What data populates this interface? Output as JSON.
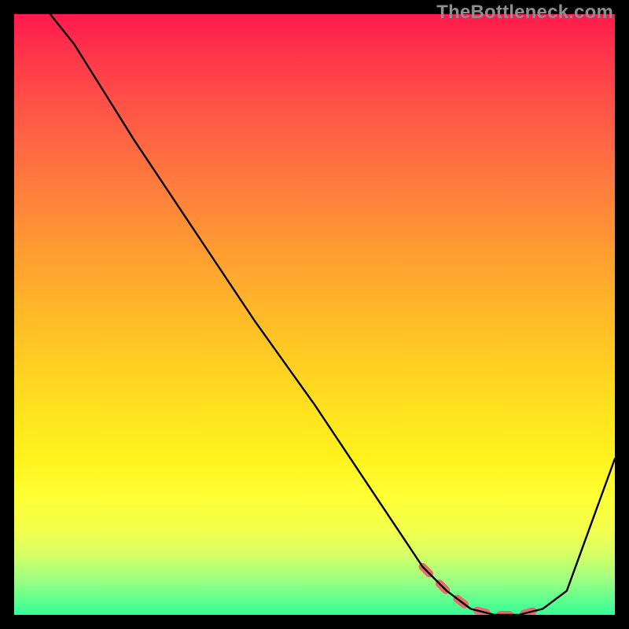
{
  "watermark": "TheBottleneck.com",
  "chart_data": {
    "type": "line",
    "title": "",
    "xlabel": "",
    "ylabel": "",
    "xlim": [
      0,
      100
    ],
    "ylim": [
      0,
      100
    ],
    "grid": false,
    "series": [
      {
        "name": "curve",
        "x": [
          6,
          10,
          20,
          30,
          40,
          50,
          60,
          68,
          72,
          76,
          80,
          84,
          88,
          92,
          100
        ],
        "values": [
          100,
          95,
          79,
          64,
          49,
          35,
          20,
          8,
          4,
          1,
          0,
          0,
          1,
          4,
          26
        ]
      },
      {
        "name": "highlight",
        "x": [
          68,
          72,
          76,
          80,
          84,
          88
        ],
        "values": [
          8,
          4,
          1,
          0,
          0,
          1
        ]
      }
    ],
    "colors": {
      "curve": "#000000",
      "highlight": "#e86a6a",
      "background_gradient": [
        "#ff1a4d",
        "#33ff99"
      ]
    }
  }
}
